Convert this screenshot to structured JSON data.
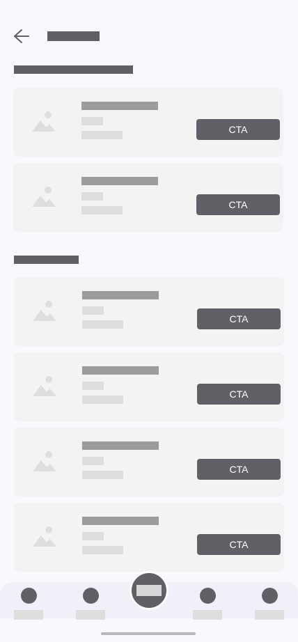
{
  "header": {
    "back_icon": "arrow-left-icon"
  },
  "sections": [
    {
      "cards": [
        {
          "cta_label": "CTA"
        },
        {
          "cta_label": "CTA"
        }
      ]
    },
    {
      "cards": [
        {
          "cta_label": "CTA"
        },
        {
          "cta_label": "CTA"
        },
        {
          "cta_label": "CTA"
        },
        {
          "cta_label": "CTA"
        }
      ]
    }
  ],
  "bottom_nav": {
    "items": [
      "nav-dot-icon",
      "nav-dot-icon",
      "nav-dot-icon",
      "nav-dot-icon"
    ],
    "center_action": "fab-icon"
  },
  "colors": {
    "background": "#f8f8fd",
    "placeholder_dark": "#5f6166",
    "placeholder_mid": "#9c9c9c",
    "placeholder_light": "#dedede",
    "card": "#f3f3f3",
    "cta_text": "#ffffff"
  }
}
